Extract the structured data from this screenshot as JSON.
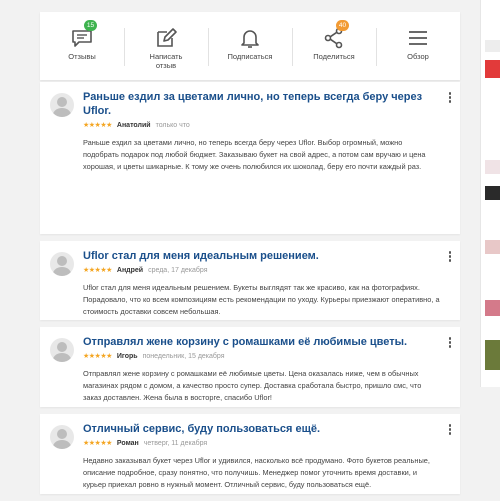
{
  "toolbar": {
    "items": [
      {
        "label": "Отзывы",
        "badge": "15",
        "icon": "comment-icon"
      },
      {
        "label": "Написать\nотзыв",
        "icon": "pencil-icon"
      },
      {
        "label": "Подписаться",
        "icon": "bell-icon"
      },
      {
        "label": "Поделиться",
        "badge": "40",
        "icon": "share-icon"
      },
      {
        "label": "Обзор",
        "icon": "menu-icon"
      }
    ]
  },
  "reviews": [
    {
      "title": "Раньше ездил за цветами лично, но теперь всегда беру через Uflor.",
      "stars": "★★★★★",
      "author": "Анатолий",
      "date": "только что",
      "text": "Раньше ездил за цветами лично, но теперь всегда беру через Uflor. Выбор огромный, можно подобрать подарок под любой бюджет. Заказываю букет на свой адрес, а потом сам вручаю и цена хорошая, и цветы шикарные. К тому же очень полюбился их шоколад, беру его почти каждый раз."
    },
    {
      "title": "Uflor стал для меня идеальным решением.",
      "stars": "★★★★★",
      "author": "Андрей",
      "date": "среда, 17 декабря",
      "text": "Uflor стал для меня идеальным решением. Букеты выглядят так же красиво, как на фотографиях. Порадовало, что ко всем композициям есть рекомендации по уходу. Курьеры приезжают оперативно, а стоимость доставки совсем небольшая."
    },
    {
      "title": "Отправлял жене корзину с ромашками её любимые цветы.",
      "stars": "★★★★★",
      "author": "Игорь",
      "date": "понедельник, 15 декабря",
      "text": "Отправлял жене корзину с ромашками её любимые цветы. Цена оказалась ниже, чем в обычных магазинах рядом с домом, а качество просто супер. Доставка сработала быстро, пришло смс, что заказ доставлен. Жена была в восторге, спасибо Uflor!"
    },
    {
      "title": "Отличный сервис, буду пользоваться ещё.",
      "stars": "★★★★★",
      "author": "Роман",
      "date": "четверг, 11 декабря",
      "text": "Недавно заказывал букет через Uflor и удивился, насколько всё продумано. Фото букетов реальные, описание подробное, сразу понятно, что получишь. Менеджер помог уточнить время доставки, и курьер приехал ровно в нужный момент. Отличный сервис, буду пользоваться ещё."
    }
  ],
  "colors": {
    "title": "#1a4f8b",
    "stars": "#f4a623",
    "badge_green": "#3fb34f",
    "badge_orange": "#f29b34"
  }
}
